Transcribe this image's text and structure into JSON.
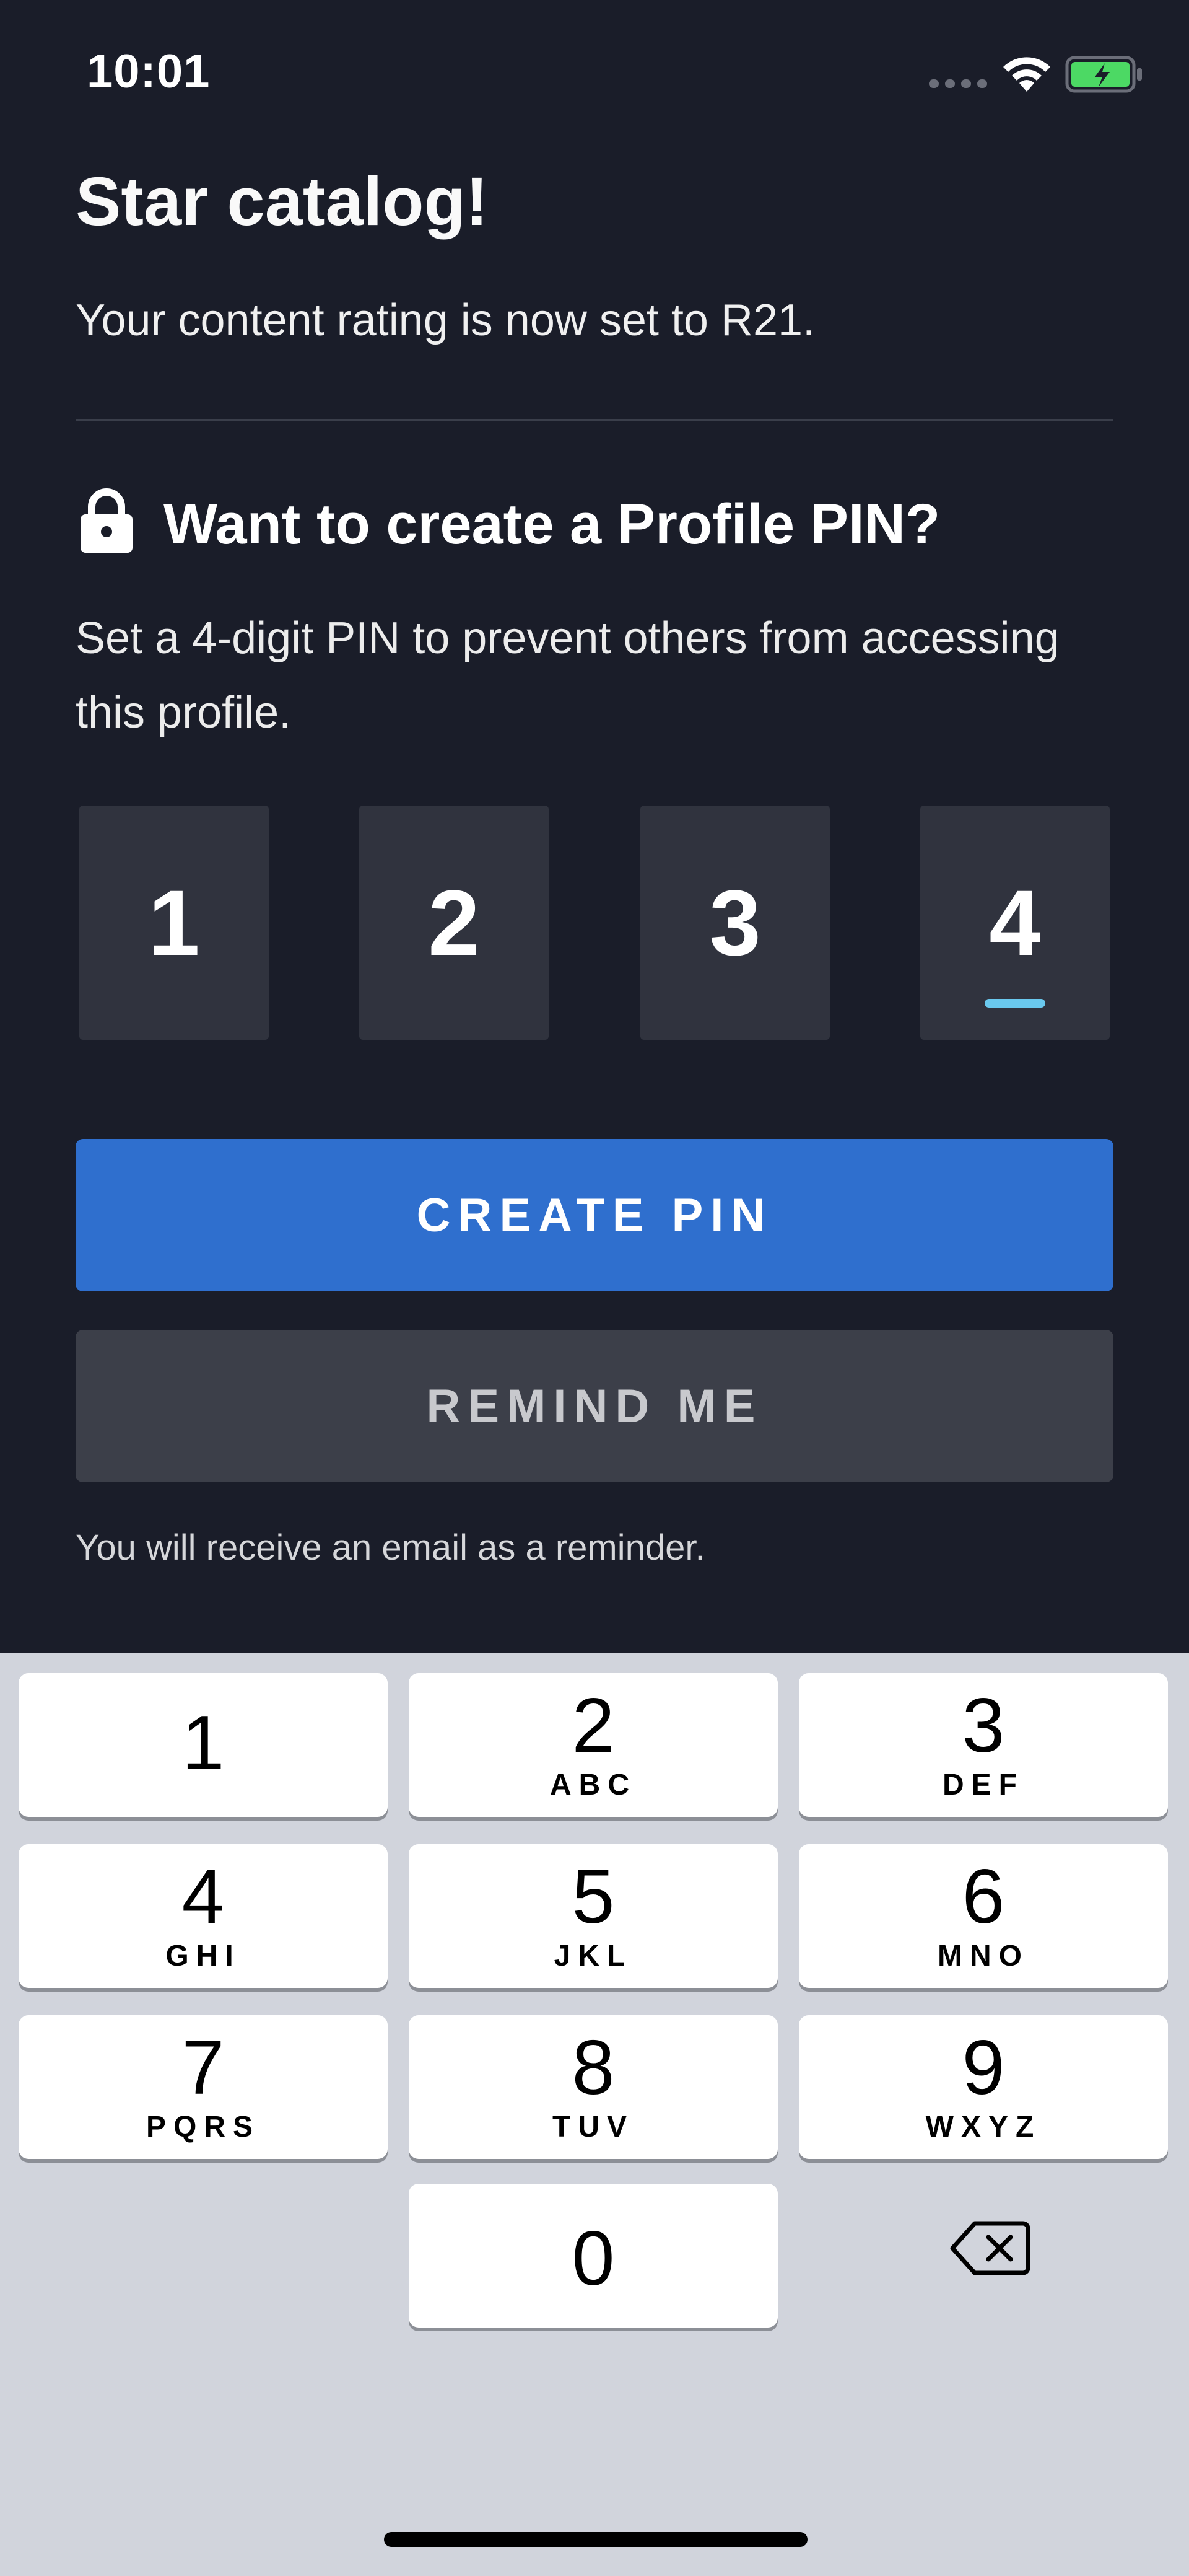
{
  "status_bar": {
    "time": "10:01"
  },
  "header": {
    "title_partial": "Star catalog!",
    "rating_message": "Your content rating is now set to R21."
  },
  "pin_prompt": {
    "title": "Want to create a Profile PIN?",
    "description": "Set a 4-digit PIN to prevent others from accessing this profile.",
    "digits": [
      "1",
      "2",
      "3",
      "4"
    ]
  },
  "actions": {
    "create_label": "CREATE PIN",
    "remind_label": "REMIND ME",
    "note": "You will receive an email as a reminder."
  },
  "keypad": {
    "keys": [
      {
        "num": "1",
        "letters": ""
      },
      {
        "num": "2",
        "letters": "ABC"
      },
      {
        "num": "3",
        "letters": "DEF"
      },
      {
        "num": "4",
        "letters": "GHI"
      },
      {
        "num": "5",
        "letters": "JKL"
      },
      {
        "num": "6",
        "letters": "MNO"
      },
      {
        "num": "7",
        "letters": "PQRS"
      },
      {
        "num": "8",
        "letters": "TUV"
      },
      {
        "num": "9",
        "letters": "WXYZ"
      },
      {
        "num": "0",
        "letters": ""
      }
    ]
  },
  "colors": {
    "background": "#1a1d29",
    "primary_button": "#2f6fce",
    "secondary_button": "#3c3f49",
    "cursor_accent": "#6ac9ee",
    "battery_charging": "#4cd964"
  }
}
